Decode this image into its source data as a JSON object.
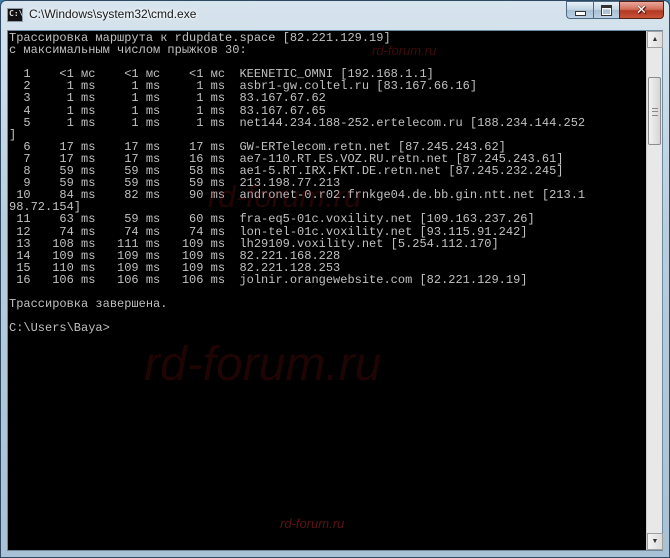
{
  "window": {
    "title": "C:\\Windows\\system32\\cmd.exe",
    "icon": "cmd-console-icon",
    "controls": {
      "minimize": "minimize-icon",
      "maximize": "maximize-icon",
      "close": "close-icon"
    }
  },
  "console": {
    "lines": [
      "Трассировка маршрута к rdupdate.space [82.221.129.19]",
      "с максимальным числом прыжков 30:",
      "",
      "  1    <1 мс    <1 мс    <1 мс  KEENETIC_OMNI [192.168.1.1]",
      "  2     1 ms     1 ms     1 ms  asbr1-gw.coltel.ru [83.167.66.16]",
      "  3     1 ms     1 ms     1 ms  83.167.67.62",
      "  4     1 ms     1 ms     1 ms  83.167.67.65",
      "  5     1 ms     1 ms     1 ms  net144.234.188-252.ertelecom.ru [188.234.144.252",
      "]",
      "  6    17 ms    17 ms    17 ms  GW-ERTelecom.retn.net [87.245.243.62]",
      "  7    17 ms    17 ms    16 ms  ae7-110.RT.ES.VOZ.RU.retn.net [87.245.243.61]",
      "  8    59 ms    59 ms    58 ms  ae1-5.RT.IRX.FKT.DE.retn.net [87.245.232.245]",
      "  9    59 ms    59 ms    59 ms  213.198.77.213",
      " 10    84 ms    82 ms    90 ms  andronet-0.r02.frnkge04.de.bb.gin.ntt.net [213.1",
      "98.72.154]",
      " 11    63 ms    59 ms    60 ms  fra-eq5-01c.voxility.net [109.163.237.26]",
      " 12    74 ms    74 ms    74 ms  lon-tel-01c.voxility.net [93.115.91.242]",
      " 13   108 ms   111 ms   109 ms  lh29109.voxility.net [5.254.112.170]",
      " 14   109 ms   109 ms   109 ms  82.221.168.228",
      " 15   110 ms   109 ms   109 ms  82.221.128.253",
      " 16   106 ms   106 ms   106 ms  jolnir.orangewebsite.com [82.221.129.19]",
      "",
      "Трассировка завершена.",
      "",
      "C:\\Users\\Baya>"
    ],
    "text_color": "#c0c0c0",
    "background": "#000000"
  },
  "watermarks": [
    "rd-forum.ru",
    "rd-forum.ru",
    "rd-forum.ru",
    "rd-forum.ru"
  ],
  "colors": {
    "frame": "#b9cedd",
    "close_button": "#c8543a"
  }
}
